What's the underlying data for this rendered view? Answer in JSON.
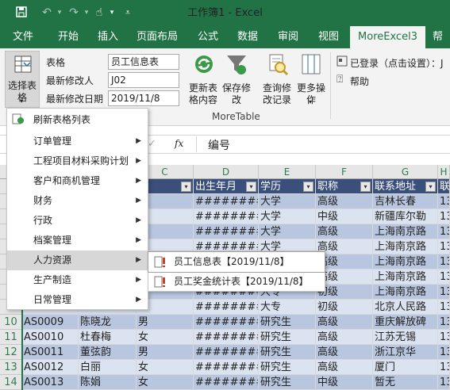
{
  "window": {
    "title": "工作簿1  -  Excel"
  },
  "ribbon_tabs": [
    "文件",
    "开始",
    "插入",
    "页面布局",
    "公式",
    "数据",
    "审阅",
    "视图",
    "MoreExcel3",
    "帮"
  ],
  "ribbon": {
    "select_table": "选择表格",
    "labels": {
      "table": "表格",
      "modifier": "最新修改人",
      "date": "最新修改日期"
    },
    "values": {
      "table": "员工信息表",
      "modifier": "J02",
      "date": "2019/11/8"
    },
    "buttons": {
      "refresh": "更新表格内容",
      "save": "保存修改",
      "query": "查询修改记录",
      "more": "更多操作"
    },
    "login": "已登录（点击设置）：J",
    "help": "帮助",
    "group": "MoreTable"
  },
  "formula": {
    "fx": "fx",
    "value": "编号"
  },
  "columns": [
    "C",
    "D",
    "E",
    "F",
    "G",
    "H"
  ],
  "header_row": [
    "别",
    "出生年月",
    "学历",
    "职称",
    "联系地址",
    "联"
  ],
  "rows": [
    {
      "n": "",
      "a": "",
      "b": "",
      "c": "",
      "d": "########",
      "e": "大学",
      "f": "高级",
      "g": "吉林长春",
      "h": "13"
    },
    {
      "n": "",
      "a": "",
      "b": "",
      "c": "",
      "d": "########",
      "e": "大学",
      "f": "中级",
      "g": "新疆库尔勒",
      "h": "13"
    },
    {
      "n": "",
      "a": "",
      "b": "",
      "c": "",
      "d": "########",
      "e": "大学",
      "f": "高级",
      "g": "上海南京路",
      "h": "13"
    },
    {
      "n": "",
      "a": "",
      "b": "",
      "c": "",
      "d": "########",
      "e": "大学",
      "f": "高级",
      "g": "上海南京路",
      "h": "13"
    },
    {
      "n": "",
      "a": "",
      "b": "",
      "c": "",
      "d": "########",
      "e": "大学",
      "f": "高级",
      "g": "上海南京路",
      "h": "13"
    },
    {
      "n": "",
      "a": "",
      "b": "",
      "c": "",
      "d": "########",
      "e": "大学",
      "f": "高级",
      "g": "上海南京路",
      "h": "13"
    },
    {
      "n": "",
      "a": "",
      "b": "",
      "c": "",
      "d": "########",
      "e": "大专",
      "f": "初级",
      "g": "上海南京路",
      "h": "13"
    },
    {
      "n": "",
      "a": "",
      "b": "",
      "c": "",
      "d": "########",
      "e": "大专",
      "f": "初级",
      "g": "北京人民路",
      "h": "13"
    },
    {
      "n": "10",
      "a": "AS0009",
      "b": "陈晓龙",
      "c": "男",
      "d": "########",
      "e": "研究生",
      "f": "高级",
      "g": "重庆解放碑",
      "h": "13"
    },
    {
      "n": "11",
      "a": "AS0010",
      "b": "杜春梅",
      "c": "女",
      "d": "########",
      "e": "研究生",
      "f": "高级",
      "g": "江苏无锡",
      "h": "13"
    },
    {
      "n": "12",
      "a": "AS0011",
      "b": "董弦韵",
      "c": "男",
      "d": "########",
      "e": "研究生",
      "f": "高级",
      "g": "浙江京华",
      "h": "13"
    },
    {
      "n": "13",
      "a": "AS0012",
      "b": "白丽",
      "c": "女",
      "d": "########",
      "e": "研究生",
      "f": "高级",
      "g": "厦门",
      "h": "13"
    },
    {
      "n": "14",
      "a": "AS0013",
      "b": "陈娟",
      "c": "女",
      "d": "########",
      "e": "研究生",
      "f": "中级",
      "g": "暂无",
      "h": "13"
    }
  ],
  "menu": [
    {
      "label": "刷新表格列表",
      "arrow": ""
    },
    {
      "label": "订单管理",
      "arrow": "▶"
    },
    {
      "label": "工程项目材料采购计划",
      "arrow": "▶"
    },
    {
      "label": "客户和商机管理",
      "arrow": "▶"
    },
    {
      "label": "财务",
      "arrow": "▶"
    },
    {
      "label": "行政",
      "arrow": "▶"
    },
    {
      "label": "档案管理",
      "arrow": "▶"
    },
    {
      "label": "人力资源",
      "arrow": "▶"
    },
    {
      "label": "生产制造",
      "arrow": "▶"
    },
    {
      "label": "日常管理",
      "arrow": "▶"
    }
  ],
  "submenu": [
    "员工信息表【2019/11/8】",
    "员工奖金统计表【2019/11/8】"
  ],
  "colors": {
    "excel_green": "#217346",
    "accent_orange": "#d04020"
  }
}
